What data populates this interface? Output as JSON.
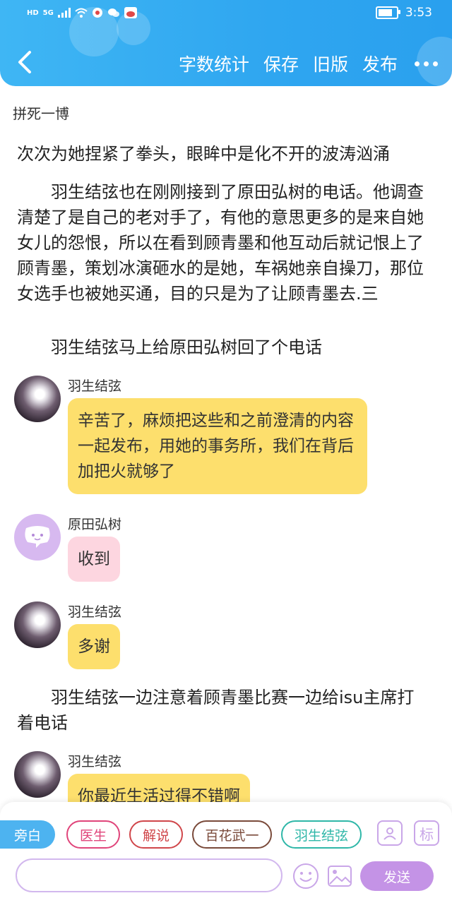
{
  "status_bar": {
    "network": "HD",
    "signal": "5G",
    "time": "3:53"
  },
  "header": {
    "actions": [
      "字数统计",
      "保存",
      "旧版",
      "发布"
    ]
  },
  "story": {
    "title": "拼死一博",
    "cutoff_line": "次次为她捏紧了拳头，眼眸中是化不开的波涛汹涌",
    "para1": "羽生结弦也在刚刚接到了原田弘树的电话。他调查清楚了是自己的老对手了，有他的意思更多的是来自她女儿的怨恨，所以在看到顾青墨和他互动后就记恨上了顾青墨，策划冰演砸水的是她，车祸她亲自操刀，那位女选手也被她买通，目的只是为了让顾青墨去.三",
    "para2": "羽生结弦马上给原田弘树回了个电话",
    "para3": "羽生结弦一边注意着顾青墨比赛一边给isu主席打着电话"
  },
  "messages": [
    {
      "name": "羽生结弦",
      "text": "辛苦了，麻烦把这些和之前澄清的内容一起发布，用她的事务所，我们在背后加把火就够了"
    },
    {
      "name": "原田弘树",
      "text": "收到"
    },
    {
      "name": "羽生结弦",
      "text": "多谢"
    },
    {
      "name": "羽生结弦",
      "text": "你最近生活过得不错啊"
    }
  ],
  "toolbar": {
    "narration": "旁白",
    "roles": [
      "医生",
      "解说",
      "百花武一",
      "羽生结弦"
    ],
    "tag_icon_label": "标",
    "send": "发送",
    "input_placeholder": ""
  },
  "colors": {
    "header": "#2fa6f0",
    "bubble_yellow": "#fddf6d",
    "bubble_pink": "#fdd6e0",
    "send": "#c493e6",
    "role_doctor": "#e0447a",
    "role_commentary": "#d0464a",
    "role_bai": "#7a4a3a",
    "role_yuzuru": "#2fb7a8"
  }
}
